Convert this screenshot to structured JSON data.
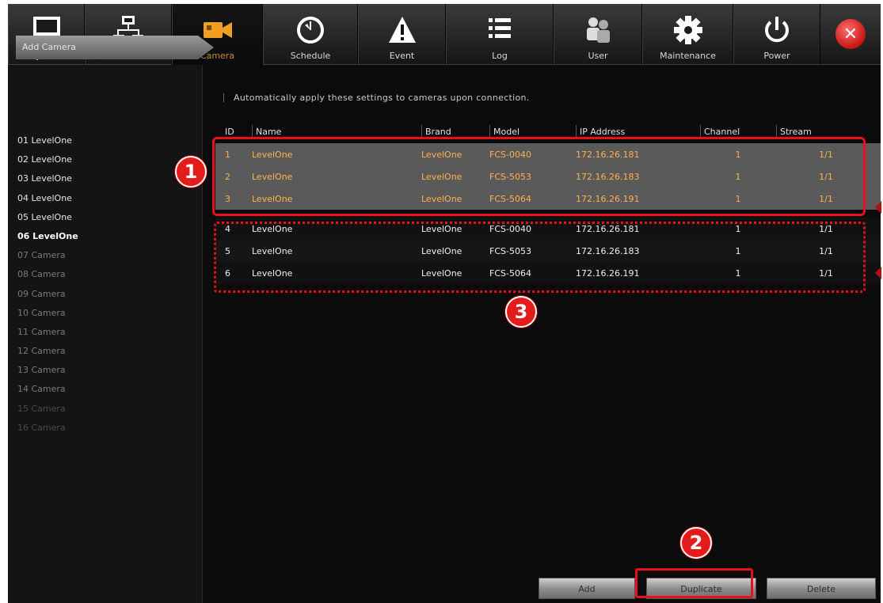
{
  "toolbar": {
    "items": [
      {
        "label": "System",
        "icon": "monitor-icon"
      },
      {
        "label": "Network",
        "icon": "network-icon"
      },
      {
        "label": "Camera",
        "icon": "camera-icon"
      },
      {
        "label": "Schedule",
        "icon": "clock-icon"
      },
      {
        "label": "Event",
        "icon": "warning-icon"
      },
      {
        "label": "Log",
        "icon": "list-icon"
      },
      {
        "label": "User",
        "icon": "users-icon"
      },
      {
        "label": "Maintenance",
        "icon": "gear-icon"
      },
      {
        "label": "Power",
        "icon": "power-icon"
      }
    ],
    "close_icon": "close-icon",
    "active_index": 2
  },
  "sidebar": {
    "add_tab_label": "Add Camera",
    "cameras": [
      "01 LevelOne",
      "02 LevelOne",
      "03 LevelOne",
      "04 LevelOne",
      "05 LevelOne",
      "06 LevelOne",
      "07 Camera",
      "08 Camera",
      "09 Camera",
      "10 Camera",
      "11 Camera",
      "12 Camera",
      "13 Camera",
      "14 Camera",
      "15 Camera",
      "16 Camera"
    ]
  },
  "main": {
    "notice": "Automatically apply these settings to cameras upon connection.",
    "columns": {
      "id": "ID",
      "name": "Name",
      "brand": "Brand",
      "model": "Model",
      "ip": "IP Address",
      "channel": "Channel",
      "stream": "Stream"
    },
    "rows": [
      {
        "id": "1",
        "name": "LevelOne",
        "brand": "LevelOne",
        "model": "FCS-0040",
        "ip": "172.16.26.181",
        "channel": "1",
        "stream": "1/1"
      },
      {
        "id": "2",
        "name": "LevelOne",
        "brand": "LevelOne",
        "model": "FCS-5053",
        "ip": "172.16.26.183",
        "channel": "1",
        "stream": "1/1"
      },
      {
        "id": "3",
        "name": "LevelOne",
        "brand": "LevelOne",
        "model": "FCS-5064",
        "ip": "172.16.26.191",
        "channel": "1",
        "stream": "1/1"
      },
      {
        "id": "4",
        "name": "LevelOne",
        "brand": "LevelOne",
        "model": "FCS-0040",
        "ip": "172.16.26.181",
        "channel": "1",
        "stream": "1/1"
      },
      {
        "id": "5",
        "name": "LevelOne",
        "brand": "LevelOne",
        "model": "FCS-5053",
        "ip": "172.16.26.183",
        "channel": "1",
        "stream": "1/1"
      },
      {
        "id": "6",
        "name": "LevelOne",
        "brand": "LevelOne",
        "model": "FCS-5064",
        "ip": "172.16.26.191",
        "channel": "1",
        "stream": "1/1"
      }
    ]
  },
  "buttons": {
    "add": "Add",
    "duplicate": "Duplicate",
    "delete": "Delete"
  },
  "annotations": {
    "one": "1",
    "two": "2",
    "three": "3"
  },
  "colors": {
    "highlight": "#e8101a",
    "selected_text": "#ffb24a",
    "active_tab_text": "#c98a2a"
  }
}
